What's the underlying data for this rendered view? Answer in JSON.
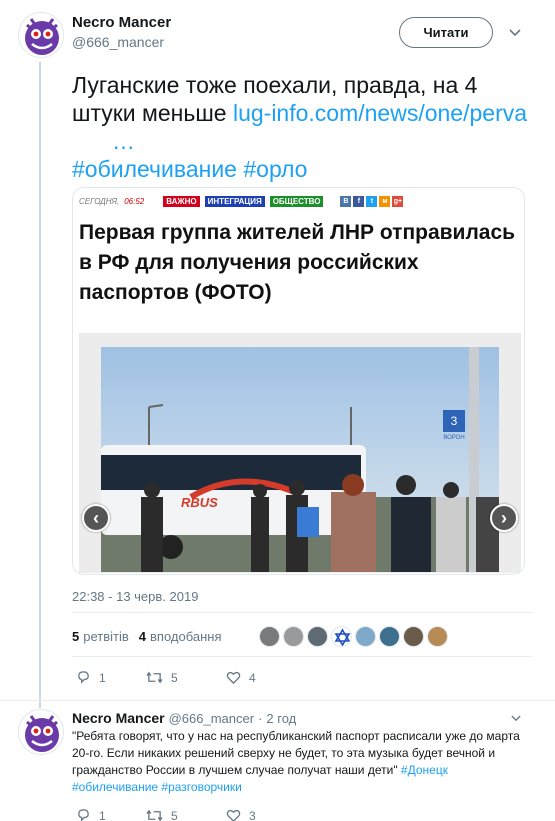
{
  "tweet": {
    "author_name": "Necro Mancer",
    "author_handle": "@666_mancer",
    "follow_label": "Читати",
    "text_main": "Луганские тоже поехали, правда, на 4 штуки меньше ",
    "link_text": "lug-info.com/news/one/perva",
    "link_ellipsis": "…",
    "hashtags": "#обилечивание #орло",
    "timestamp": "22:38 - 13 черв. 2019",
    "retweets_count": "5",
    "retweets_label": "ретвітів",
    "likes_count": "4",
    "likes_label": "вподобання",
    "reply_count": "1",
    "retweet_action_count": "5",
    "like_action_count": "4"
  },
  "card": {
    "date_label": "СЕГОДНЯ,",
    "time_label": "06:52",
    "tags": [
      "ВАЖНО",
      "ИНТЕГРАЦИЯ",
      "ОБЩЕСТВО"
    ],
    "tag_colors": [
      "#d3001c",
      "#1f3fb5",
      "#1a8f2a"
    ],
    "social": [
      "В",
      "f",
      "t",
      "м",
      "g+"
    ],
    "title": "Первая группа жителей ЛНР отправилась в РФ для получения российских паспортов (ФОТО)",
    "prev_icon": "chevron-left-icon",
    "next_icon": "chevron-right-icon",
    "photo_sign_number": "3",
    "photo_sign_text": "ВОРОН",
    "bus_brand": "RBUS"
  },
  "reply": {
    "author_name": "Necro Mancer",
    "author_handle": "@666_mancer",
    "separator": "·",
    "time": "2 год",
    "text": "\"Ребята говорят, что у нас на республиканский паспорт расписали уже до марта 20-го. Если никаких решений сверху не будет, то эта музыка будет вечной и гражданство России в лучшем случае получат наши дети\"",
    "hashtags_inline": "#Донецк",
    "hashtags_line2": "#обилечивание #разговорчики",
    "reply_count": "1",
    "retweet_count": "5",
    "like_count": "3"
  },
  "colors": {
    "link": "#1da1f2",
    "secondary_text": "#657786",
    "border": "#e1e8ed"
  }
}
